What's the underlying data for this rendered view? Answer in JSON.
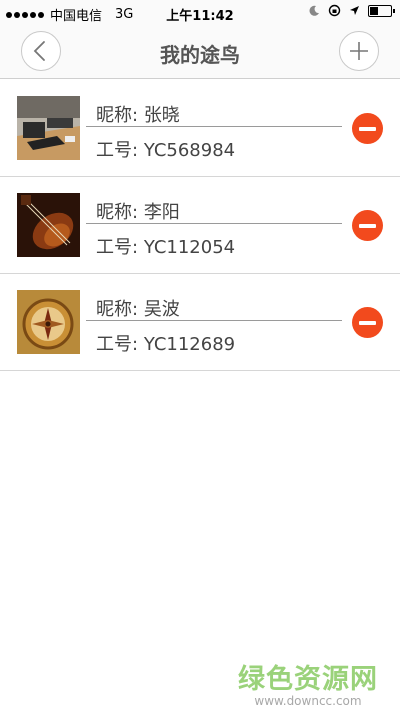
{
  "status_bar": {
    "carrier": "中国电信",
    "network": "3G",
    "time": "上午11:42"
  },
  "nav": {
    "title": "我的途鸟",
    "back_icon": "chevron-left-icon",
    "add_icon": "plus-icon"
  },
  "members": [
    {
      "nickname_label": "昵称:",
      "nickname": "张晓",
      "id_label": "工号:",
      "id": "YC568984",
      "thumb": "desk-photo"
    },
    {
      "nickname_label": "昵称:",
      "nickname": "李阳",
      "id_label": "工号:",
      "id": "YC112054",
      "thumb": "violin-photo"
    },
    {
      "nickname_label": "昵称:",
      "nickname": "吴波",
      "id_label": "工号:",
      "id": "YC112689",
      "thumb": "compass-photo"
    }
  ],
  "colors": {
    "remove_button": "#f24a1d",
    "watermark": "#9ad27a"
  },
  "watermark": {
    "title": "绿色资源网",
    "url": "www.downcc.com"
  }
}
